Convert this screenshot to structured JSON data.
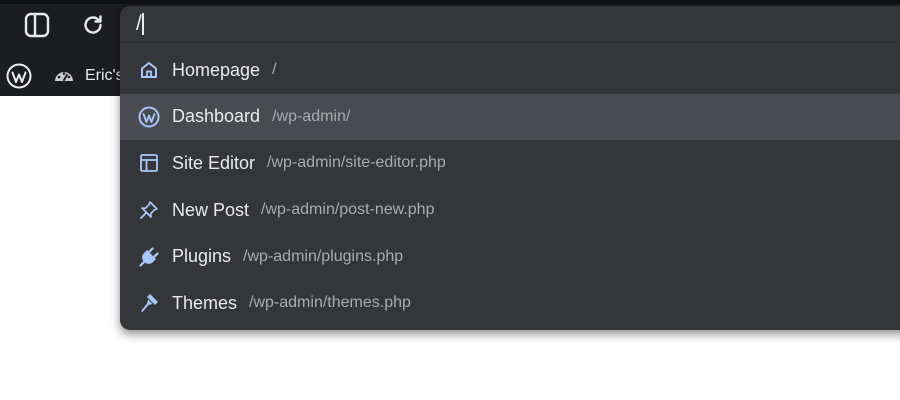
{
  "browser": {
    "address_input": "/",
    "bookmarks": [
      {
        "label": "Eric's"
      }
    ]
  },
  "suggestions": [
    {
      "title": "Homepage",
      "url": "/",
      "icon": "home-icon"
    },
    {
      "title": "Dashboard",
      "url": "/wp-admin/",
      "icon": "wordpress-icon",
      "selected": true
    },
    {
      "title": "Site Editor",
      "url": "/wp-admin/site-editor.php",
      "icon": "layout-icon"
    },
    {
      "title": "New Post",
      "url": "/wp-admin/post-new.php",
      "icon": "pin-icon"
    },
    {
      "title": "Plugins",
      "url": "/wp-admin/plugins.php",
      "icon": "plugin-icon"
    },
    {
      "title": "Themes",
      "url": "/wp-admin/themes.php",
      "icon": "brush-icon"
    }
  ],
  "colors": {
    "toolbar_bg": "#1c1d20",
    "dropdown_bg": "#35363a",
    "selected_row": "#494b50",
    "icon_accent": "#a8c7fa",
    "text": "#e8eaed",
    "url_text": "#a8abb0"
  }
}
